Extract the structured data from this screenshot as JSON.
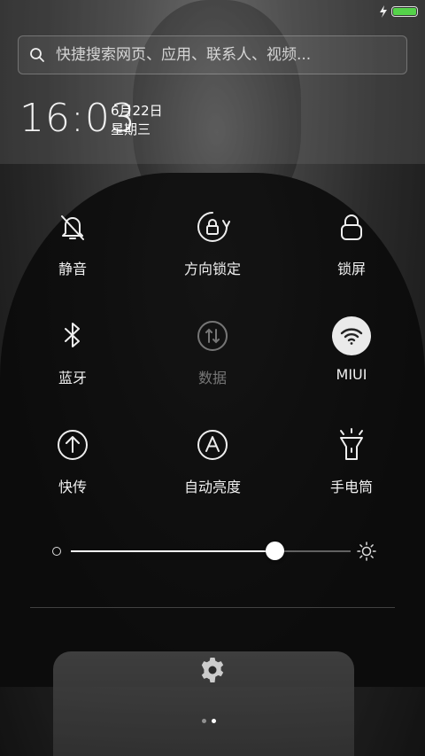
{
  "status_bar": {
    "battery_level": 1.0,
    "charging_icon": "bolt-icon",
    "battery_color": "#55d24a"
  },
  "search": {
    "placeholder": "快捷搜索网页、应用、联系人、视频..."
  },
  "clock": {
    "time": "16:03",
    "date": "6月22日",
    "weekday": "星期三"
  },
  "toggles": [
    {
      "label": "静音",
      "icon": "bell-off-icon",
      "state": "off"
    },
    {
      "label": "方向锁定",
      "icon": "rotation-lock-icon",
      "state": "off"
    },
    {
      "label": "锁屏",
      "icon": "lock-icon",
      "state": "off"
    },
    {
      "label": "蓝牙",
      "icon": "bluetooth-icon",
      "state": "off"
    },
    {
      "label": "数据",
      "icon": "mobile-data-icon",
      "state": "disabled"
    },
    {
      "label": "MIUI",
      "icon": "wifi-icon",
      "state": "on"
    },
    {
      "label": "快传",
      "icon": "transfer-icon",
      "state": "off"
    },
    {
      "label": "自动亮度",
      "icon": "auto-brightness-icon",
      "state": "off"
    },
    {
      "label": "手电筒",
      "icon": "flashlight-icon",
      "state": "off"
    }
  ],
  "brightness": {
    "level": 0.73
  },
  "pager": {
    "pages": 2,
    "current": 2
  }
}
